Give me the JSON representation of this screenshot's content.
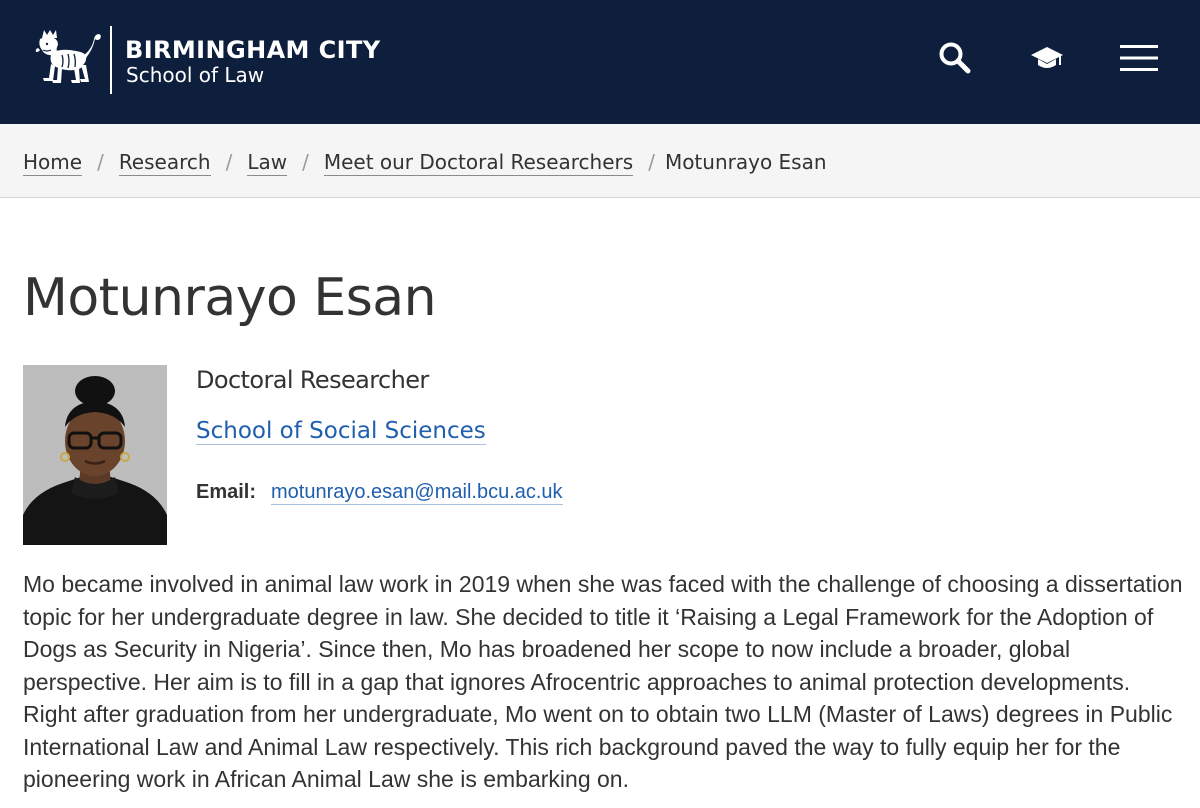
{
  "header": {
    "logo_line1": "BIRMINGHAM CITY",
    "logo_line2": "School of Law",
    "icons": [
      "lion-crest-icon",
      "search-icon",
      "graduation-cap-icon",
      "menu-icon"
    ],
    "background_color": "#0d1f3c"
  },
  "breadcrumb": {
    "items": [
      "Home",
      "Research",
      "Law",
      "Meet our Doctoral Researchers"
    ],
    "separator": "/",
    "current": "Motunrayo Esan"
  },
  "profile": {
    "name": "Motunrayo Esan",
    "role": "Doctoral Researcher",
    "school": "School of Social Sciences",
    "email_label": "Email:",
    "email": "motunrayo.esan@mail.bcu.ac.uk",
    "bio": "Mo became involved in animal law work in 2019 when she was faced with the challenge of choosing a dissertation topic for her undergraduate degree in law. She decided to title it ‘Raising a Legal Framework for the Adoption of Dogs as Security in Nigeria’. Since then, Mo has broadened her scope to now include a broader, global perspective. Her aim is to fill in a gap that ignores Afrocentric approaches to animal protection developments. Right after graduation from her undergraduate, Mo went on to obtain two LLM (Master of Laws) degrees in Public International Law and Animal Law respectively. This rich background paved the way to fully equip her for the pioneering work in African Animal Law she is embarking on."
  },
  "colors": {
    "link": "#1f5fae",
    "text": "#333333",
    "breadcrumb_bg": "#f5f5f5"
  }
}
